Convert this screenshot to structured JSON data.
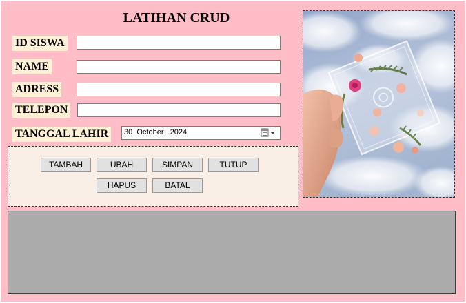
{
  "form": {
    "title": "LATIHAN CRUD",
    "fields": {
      "id_siswa": {
        "label": "ID SISWA",
        "value": ""
      },
      "name": {
        "label": "NAME",
        "value": ""
      },
      "adress": {
        "label": "ADRESS",
        "value": ""
      },
      "telepon": {
        "label": "TELEPON",
        "value": ""
      },
      "tanggal_lahir": {
        "label": "TANGGAL LAHIR",
        "value": "30  October   2024"
      }
    },
    "buttons": {
      "tambah": "TAMBAH",
      "ubah": "UBAH",
      "simpan": "SIMPAN",
      "tutup": "TUTUP",
      "hapus": "HAPUS",
      "batal": "BATAL"
    }
  },
  "colors": {
    "background": "#ffbdc8",
    "label_background": "#fff0d6",
    "panel_background": "#faefe6",
    "table_background": "#ababab",
    "button_face": "#e1e1e1"
  },
  "icons": {
    "date_picker": "calendar-dropdown-icon"
  }
}
